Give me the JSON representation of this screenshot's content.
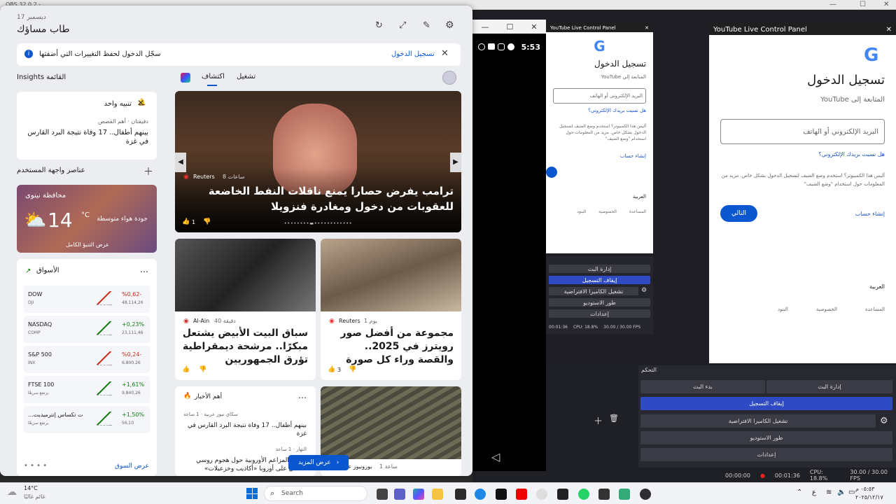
{
  "obs_top": {
    "left_text": "OBS 32.0.2 - ...",
    "win_controls": [
      "—",
      "☐",
      "✕"
    ]
  },
  "phone": {
    "time": "5:53",
    "status_icons": [
      "whatsapp-icon",
      "message-icon",
      "instagram-icon",
      "messenger-icon"
    ],
    "win_controls": [
      "—",
      "☐",
      "✕"
    ]
  },
  "login_small": {
    "window_title": "YouTube Live Control Panel",
    "heading": "تسجيل الدخول",
    "subtitle": "المتابعة إلى YouTube",
    "email_placeholder": "البريد الإلكتروني أو الهاتف",
    "forgot": "هل نسيت بريدك الإلكتروني؟",
    "guest_text": "أليس هذا الكمبيوتر؟ استخدم وضع الضيف لتسجيل الدخول بشكل خاص. مزيد من المعلومات حول استخدام \"وضع الضيف\"",
    "create": "إنشاء حساب",
    "language": "العربية",
    "footer": [
      "المساعدة",
      "الخصوصية",
      "البنود"
    ]
  },
  "login_large": {
    "window_title": "YouTube Live Control Panel",
    "heading": "تسجيل الدخول",
    "subtitle": "المتابعة إلى YouTube",
    "email_placeholder": "البريد الإلكتروني أو الهاتف",
    "forgot": "هل نسيت بريدك الإلكتروني؟",
    "guest_text": "أليس هذا الكمبيوتر؟ استخدم وضع الضيف لتسجيل الدخول بشكل خاص. مزيد من المعلومات حول استخدام \"وضع الضيف\"",
    "next": "التالي",
    "create": "إنشاء حساب",
    "language": "العربية",
    "footer": [
      "المساعدة",
      "الخصوصية",
      "البنود"
    ]
  },
  "obs_small_controls": [
    "إدارة البث",
    "إيقاف التسجيل",
    "تشغيل الكاميرا الافتراضية",
    "طور الاستوديو",
    "إعدادات"
  ],
  "obs_small_status": {
    "time": "00:01:36",
    "cpu": "CPU: 18.8%",
    "fps": "30.00 / 30.00 FPS"
  },
  "obs_dock": {
    "title": "التحكم",
    "start_stream": "بدء البث",
    "manage_stream": "إدارة البث",
    "stop_recording": "إيقاف التسجيل",
    "virtual_cam": "تشغيل الكاميرا الافتراضية",
    "studio_mode": "طور الاستوديو",
    "settings": "إعدادات"
  },
  "obs_status": {
    "stream_time": "00:00:00",
    "rec_time": "00:01:36",
    "cpu": "CPU: 18.8%",
    "fps": "30.00 / 30.00 FPS"
  },
  "widgets": {
    "date": "17 ديسمبر",
    "greeting": "طاب مساؤك",
    "signin_banner": {
      "text": "سجّل الدخول لحفظ التغييرات التي أضفتها",
      "link": "تسجيل الدخول"
    },
    "tabs": {
      "discover": "اكتشاف",
      "play": "تشغيل"
    },
    "insights_title": "Insights القائمة",
    "alert": {
      "title": "تنبيه واحد",
      "source": "دقيقتان · أهم القصص",
      "headline": "بينهم أطفال.. 17 وفاة نتيجة البرد القارس في غزة"
    },
    "manage_widgets": "عناصر واجهة المستخدم",
    "weather": {
      "location": "محافظة نينوى",
      "temp": "14",
      "unit": "°C",
      "air": "جودة هواء متوسطة",
      "forecast": "عرض التنبؤ الكامل"
    },
    "markets": {
      "title": "الأسواق",
      "more": "عرض السوق",
      "rows": [
        {
          "name": "DOW",
          "sub": "DJI",
          "change": "%0,62-",
          "value": "48,114,26",
          "color": "#c42b1c"
        },
        {
          "name": "NASDAQ",
          "sub": "COMP",
          "change": "+0,23%",
          "value": "23,111,46",
          "color": "#0f7b0f"
        },
        {
          "name": "S&P 500",
          "sub": "INX",
          "change": "%0,24-",
          "value": "6,800,26",
          "color": "#c42b1c"
        },
        {
          "name": "FTSE 100",
          "sub": "يرتفع سريعًا",
          "change": "+1,61%",
          "value": "9,840,26",
          "color": "#0f7b0f"
        },
        {
          "name": "...ت تكساس إنترميديت",
          "sub": "يرتفع سريعًا",
          "change": "+1,50%",
          "value": "56,10",
          "color": "#0f7b0f"
        }
      ]
    },
    "hero": {
      "source": "Reuters",
      "time": "8 ساعات",
      "headline": "ترامب يفرض حصارا يمنع ناقلات النفط الخاضعة للعقوبات من دخول ومغادرة فنزويلا",
      "likes": "1"
    },
    "news1": {
      "source": "Al-Ain",
      "time": "40 دقيقة",
      "headline": "سباق البيت الأبيض يشتعل مبكرًا.. مرشحة ديمقراطية تؤرق الجمهوريين"
    },
    "news2": {
      "source": "Reuters",
      "time": "1 يوم",
      "headline": "مجموعة من أفضل صور رويترز في 2025.. والقصة وراء كل صورة",
      "likes": "3"
    },
    "top_news": {
      "title": "أهم الأخبار",
      "item1_source": "سكاي نيوز عربية · 1 ساعة",
      "item1": "بينهم أطفال.. 17 وفاة نتيجة البرد القارس في غزة",
      "item2_source": "النهار · 1 ساعة",
      "item2": "بوتين: المزاعم الأوروبية حول هجوم روسي محتمل على أوروبا «أكاذيب وخزعبلات»"
    },
    "news4": {
      "source": "يورونيوز عربي",
      "time": "1 ساعة"
    },
    "see_more": "عرض المزيد"
  },
  "taskbar": {
    "weather_temp": "14°C",
    "weather_text": "غائم غالبًا",
    "search": "Search",
    "time": "٠٥:٥٣ م",
    "date": "٢٠٢٥/١٢/١٧"
  }
}
